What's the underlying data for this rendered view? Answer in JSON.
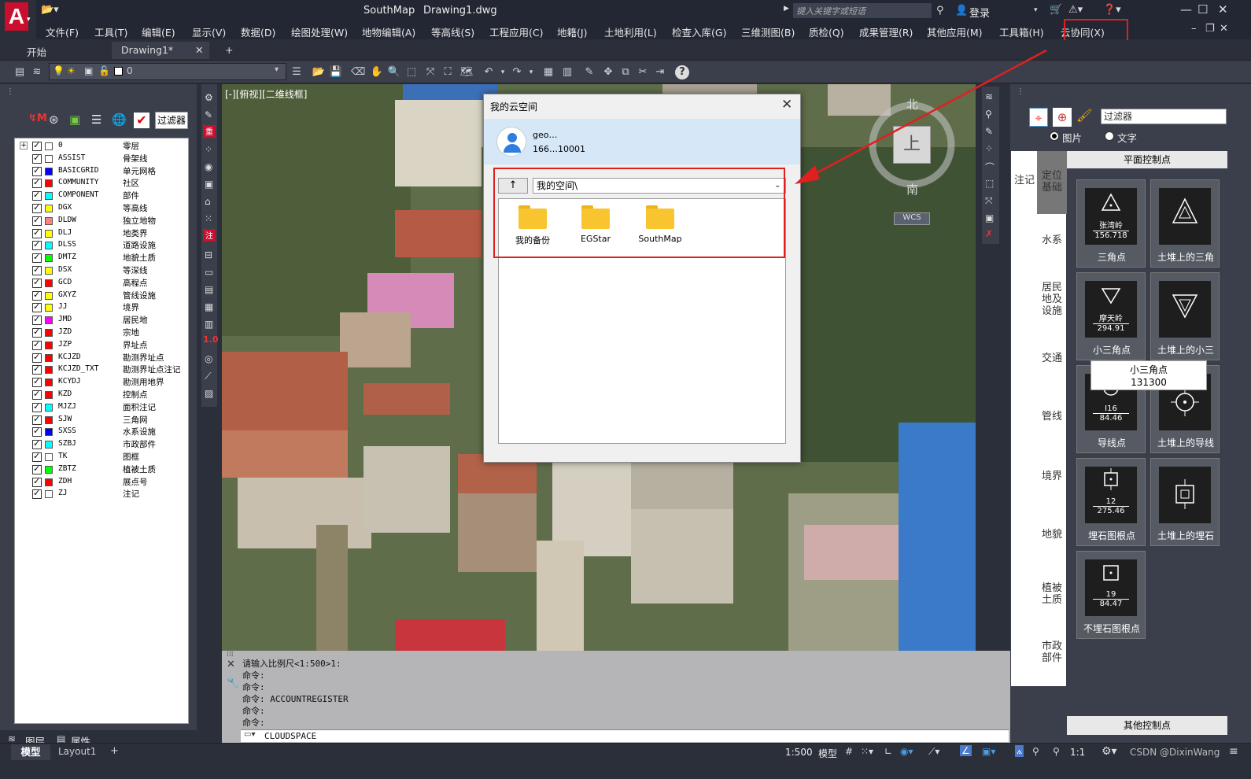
{
  "app": {
    "title": "SouthMap",
    "file": "Drawing1.dwg",
    "search_placeholder": "键入关键字或短语",
    "login": "登录"
  },
  "menu": [
    "文件(F)",
    "工具(T)",
    "编辑(E)",
    "显示(V)",
    "数据(D)",
    "绘图处理(W)",
    "地物编辑(A)",
    "等高线(S)",
    "工程应用(C)",
    "地籍(J)",
    "土地利用(L)",
    "检查入库(G)",
    "三维测图(B)",
    "质检(Q)",
    "成果管理(R)",
    "其他应用(M)",
    "工具箱(H)",
    "云协同(X)"
  ],
  "tabs": {
    "start": "开始",
    "drawing": "Drawing1*",
    "add": "+"
  },
  "toolbar": {
    "layer_value": "0",
    "help": "?"
  },
  "view_label": "[-][俯视][二维线框]",
  "layers": {
    "filter": "过滤器",
    "rows": [
      {
        "name": "0",
        "cn": "零层",
        "color": "#ffffff"
      },
      {
        "name": "ASSIST",
        "cn": "骨架线",
        "color": "#ffffff"
      },
      {
        "name": "BASICGRID",
        "cn": "单元网格",
        "color": "#0000ff"
      },
      {
        "name": "COMMUNITY",
        "cn": "社区",
        "color": "#ff0000"
      },
      {
        "name": "COMPONENT",
        "cn": "部件",
        "color": "#00ffff"
      },
      {
        "name": "DGX",
        "cn": "等高线",
        "color": "#ffff00"
      },
      {
        "name": "DLDW",
        "cn": "独立地物",
        "color": "#ff8080"
      },
      {
        "name": "DLJ",
        "cn": "地类界",
        "color": "#ffff00"
      },
      {
        "name": "DLSS",
        "cn": "道路设施",
        "color": "#00ffff"
      },
      {
        "name": "DMTZ",
        "cn": "地貌土质",
        "color": "#00ff00"
      },
      {
        "name": "DSX",
        "cn": "等深线",
        "color": "#ffff00"
      },
      {
        "name": "GCD",
        "cn": "高程点",
        "color": "#ff0000"
      },
      {
        "name": "GXYZ",
        "cn": "管线设施",
        "color": "#ffff00"
      },
      {
        "name": "JJ",
        "cn": "境界",
        "color": "#ffff00"
      },
      {
        "name": "JMD",
        "cn": "居民地",
        "color": "#ff00ff"
      },
      {
        "name": "JZD",
        "cn": "宗地",
        "color": "#ff0000"
      },
      {
        "name": "JZP",
        "cn": "界址点",
        "color": "#ff0000"
      },
      {
        "name": "KCJZD",
        "cn": "勘测界址点",
        "color": "#ff0000"
      },
      {
        "name": "KCJZD_TXT",
        "cn": "勘测界址点注记",
        "color": "#ff0000"
      },
      {
        "name": "KCYDJ",
        "cn": "勘测用地界",
        "color": "#ff0000"
      },
      {
        "name": "KZD",
        "cn": "控制点",
        "color": "#ff0000"
      },
      {
        "name": "MJZJ",
        "cn": "面积注记",
        "color": "#00ffff"
      },
      {
        "name": "SJW",
        "cn": "三角网",
        "color": "#ff0000"
      },
      {
        "name": "SXSS",
        "cn": "水系设施",
        "color": "#0000ff"
      },
      {
        "name": "SZBJ",
        "cn": "市政部件",
        "color": "#00ffff"
      },
      {
        "name": "TK",
        "cn": "图框",
        "color": "#ffffff"
      },
      {
        "name": "ZBTZ",
        "cn": "植被土质",
        "color": "#00ff00"
      },
      {
        "name": "ZDH",
        "cn": "展点号",
        "color": "#ff0000"
      },
      {
        "name": "ZJ",
        "cn": "注记",
        "color": "#ffffff"
      }
    ],
    "tab_layers": "图层",
    "tab_props": "属性"
  },
  "dialog": {
    "title": "我的云空间",
    "close": "✕",
    "user_name": "geo…",
    "user_id": "166…10001",
    "up": "↑",
    "path": "我的空间\\",
    "folders": [
      "我的备份",
      "EGStar",
      "SouthMap"
    ]
  },
  "compass": {
    "north": "北",
    "south": "南",
    "top": "上",
    "wcs": "WCS"
  },
  "right_panel": {
    "search": "过滤器",
    "radio_image": "图片",
    "radio_text": "文字",
    "categories": [
      "注记",
      "定位基础",
      "水系",
      "居民地及设施",
      "交通",
      "管线",
      "境界",
      "地貌",
      "植被土质",
      "市政部件"
    ],
    "header": "平面控制点",
    "footer": "其他控制点",
    "symbols": [
      {
        "label": "三角点",
        "name": "张湾岭",
        "value": "156.718"
      },
      {
        "label": "土堆上的三角",
        "name": "",
        "value": ""
      },
      {
        "label": "小三角点",
        "name": "摩天岭",
        "value": "294.91"
      },
      {
        "label": "土堆上的小三",
        "name": "",
        "value": ""
      },
      {
        "label": "导线点",
        "name": "I16",
        "value": "84.46"
      },
      {
        "label": "土堆上的导线",
        "name": "",
        "value": ""
      },
      {
        "label": "埋石图根点",
        "name": "12",
        "value": "275.46"
      },
      {
        "label": "土堆上的埋石",
        "name": "",
        "value": ""
      },
      {
        "label": "不埋石图根点",
        "name": "19",
        "value": "84.47"
      }
    ],
    "tooltip_title": "小三角点",
    "tooltip_code": "131300"
  },
  "command": {
    "lines": [
      "请输入比例尺<1:500>1:",
      "命令:",
      "命令:",
      "命令: ACCOUNTREGISTER",
      "命令:",
      "命令:"
    ],
    "input": "CLOUDSPACE"
  },
  "status": {
    "model_tab": "模型",
    "layout_tab": "Layout1",
    "add": "+",
    "scale": "1:500",
    "mode": "模型",
    "ratio": "1:1",
    "watermark": "CSDN @DixinWang"
  }
}
